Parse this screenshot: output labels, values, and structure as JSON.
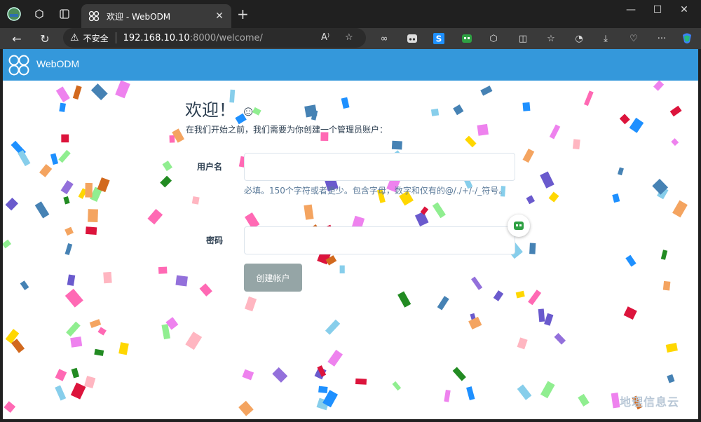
{
  "browser": {
    "tab_title": "欢迎 - WebODM",
    "security_label": "不安全",
    "url_host": "192.168.10.10",
    "url_rest": ":8000/welcome/"
  },
  "navbar": {
    "brand": "WebODM",
    "color": "#3498db"
  },
  "welcome": {
    "title": "欢迎！",
    "smile": "☺",
    "subtitle": "在我们开始之前，我们需要为你创建一个管理员账户："
  },
  "form": {
    "username_label": "用户名",
    "username_value": "",
    "username_help": "必填。150个字符或者更少。包含字母，数字和仅有的@/./+/-/_符号。",
    "password_label": "密码",
    "password_value": "",
    "submit_label": "创建帐户",
    "submit_color": "#95a5a6"
  },
  "watermark": "地理信息云",
  "icons": [
    "profile-avatar-icon",
    "workspaces-icon",
    "tab-actions-icon",
    "webodm-logo-icon",
    "close-icon",
    "plus-icon",
    "back-icon",
    "refresh-icon",
    "warning-icon",
    "read-aloud-icon",
    "star-icon",
    "extension-icon",
    "split-screen-icon",
    "favorites-icon",
    "history-icon",
    "download-icon",
    "heart-pulse-icon",
    "more-icon",
    "copilot-icon"
  ]
}
